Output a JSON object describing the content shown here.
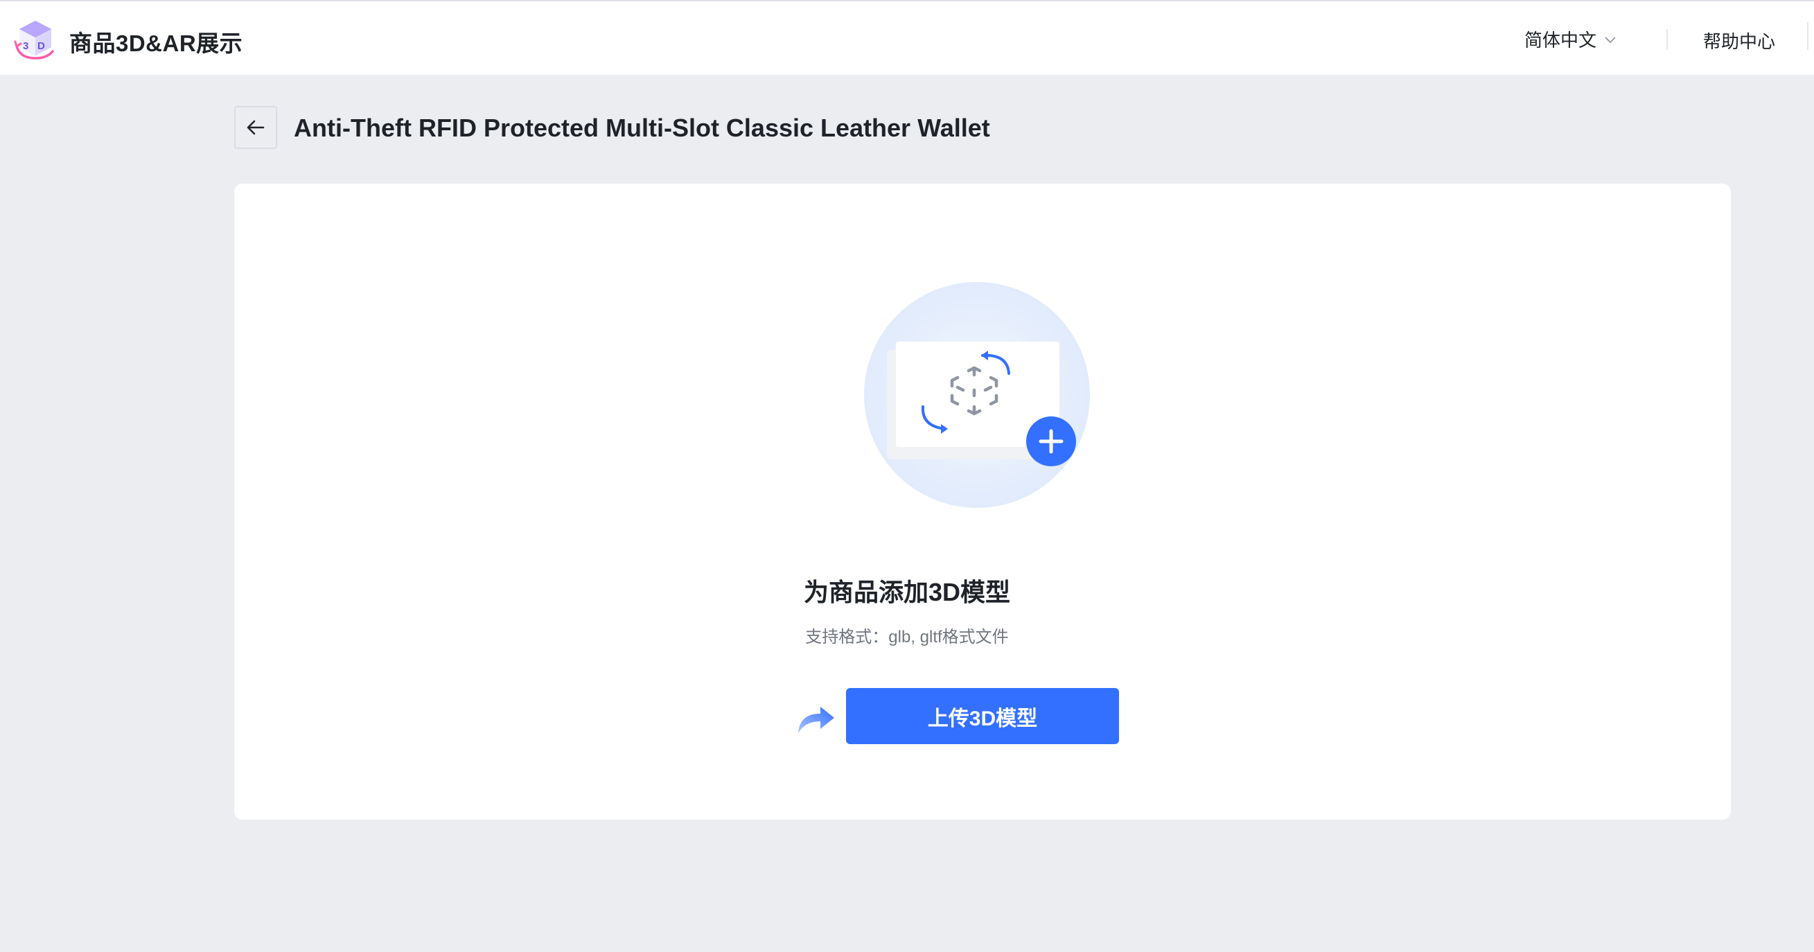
{
  "header": {
    "app_title": "商品3D&AR展示",
    "language": "简体中文",
    "help": "帮助中心"
  },
  "page": {
    "title": "Anti-Theft RFID Protected Multi-Slot Classic Leather Wallet"
  },
  "empty_state": {
    "heading": "为商品添加3D模型",
    "formats": "支持格式：glb, gltf格式文件",
    "upload_label": "上传3D模型"
  },
  "icons": [
    "logo-3d-cube-icon",
    "chevron-down-icon",
    "arrow-left-icon",
    "3d-model-illustration-icon",
    "plus-icon",
    "curved-arrow-icon"
  ],
  "colors": {
    "primary": "#3370ff",
    "page_background": "#ebedf1",
    "card_background": "#ffffff",
    "illustration_circle": "#e6effd",
    "logo_purple": "#7b61ff",
    "logo_pink": "#ff5ca8"
  }
}
